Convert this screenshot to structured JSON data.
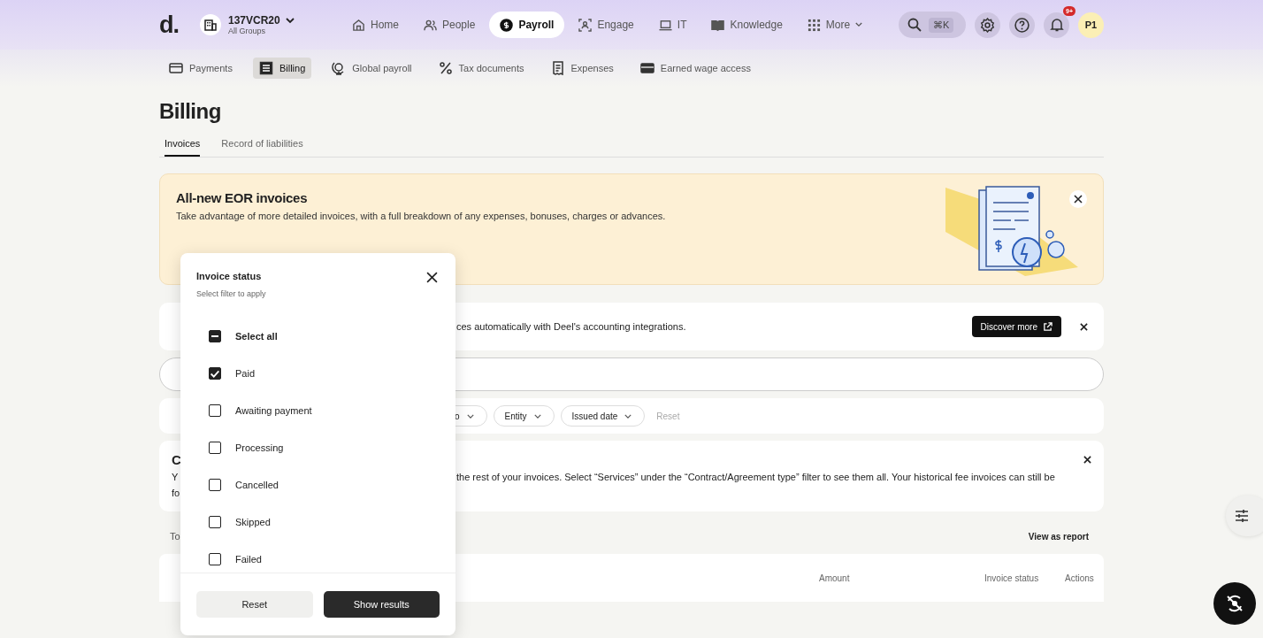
{
  "topbar": {
    "logo": "d.",
    "org": {
      "name": "137VCR20",
      "group": "All Groups"
    },
    "nav": [
      {
        "label": "Home",
        "selected": false
      },
      {
        "label": "People",
        "selected": false
      },
      {
        "label": "Payroll",
        "selected": true
      },
      {
        "label": "Engage",
        "selected": false
      },
      {
        "label": "IT",
        "selected": false
      },
      {
        "label": "Knowledge",
        "selected": false
      },
      {
        "label": "More",
        "selected": false
      }
    ],
    "search_shortcut": "⌘K",
    "notifications_badge": "9+",
    "avatar": "P1"
  },
  "subnav": [
    {
      "label": "Payments",
      "selected": false
    },
    {
      "label": "Billing",
      "selected": true
    },
    {
      "label": "Global payroll",
      "selected": false
    },
    {
      "label": "Tax documents",
      "selected": false
    },
    {
      "label": "Expenses",
      "selected": false
    },
    {
      "label": "Earned wage access",
      "selected": false
    }
  ],
  "page_title": "Billing",
  "tabs": [
    {
      "label": "Invoices",
      "selected": true
    },
    {
      "label": "Record of liabilities",
      "selected": false
    }
  ],
  "banner": {
    "title": "All-new EOR invoices",
    "text": "Take advantage of more detailed invoices, with a full breakdown of any expenses, bonuses, charges or advances."
  },
  "integration_card": {
    "text": "ces automatically with Deel's accounting integrations.",
    "button": "Discover more"
  },
  "filters": {
    "chips": [
      "o",
      "Entity",
      "Issued date"
    ],
    "reset": "Reset"
  },
  "notice": {
    "title": "C",
    "left_lines": [
      "Y",
      "fo"
    ],
    "text": "the rest of your invoices. Select “Services” under the “Contract/Agreement type” filter to see them all. Your historical fee invoices can still be"
  },
  "table": {
    "total_label": "To",
    "report_link": "View as report",
    "columns": [
      "Amount",
      "Invoice status",
      "Actions"
    ]
  },
  "popup": {
    "title": "Invoice status",
    "subtitle": "Select filter to apply",
    "select_all": {
      "label": "Select all",
      "indeterminate": true
    },
    "options": [
      {
        "label": "Paid",
        "checked": true
      },
      {
        "label": "Awaiting payment",
        "checked": false
      },
      {
        "label": "Processing",
        "checked": false
      },
      {
        "label": "Cancelled",
        "checked": false
      },
      {
        "label": "Skipped",
        "checked": false
      },
      {
        "label": "Failed",
        "checked": false
      }
    ],
    "buttons": [
      {
        "label": "Reset",
        "kind": "secondary"
      },
      {
        "label": "Show results",
        "kind": "primary"
      }
    ]
  }
}
